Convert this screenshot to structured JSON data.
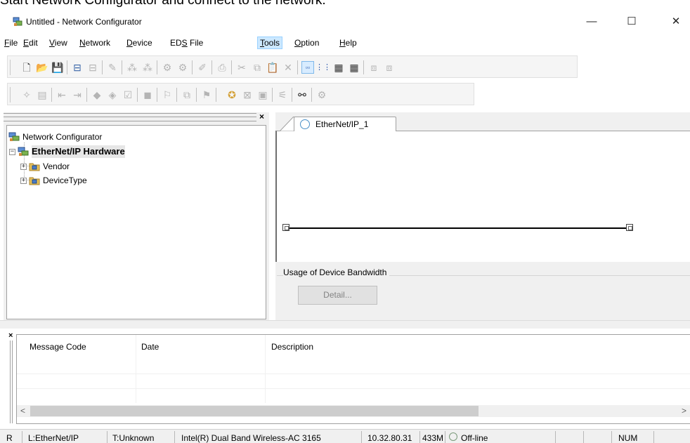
{
  "caption": "Start Network Configurator and connect to the network.",
  "window": {
    "title": "Untitled - Network Configurator",
    "controls": {
      "minimize": "—",
      "maximize": "☐",
      "close": "✕"
    }
  },
  "menubar": [
    {
      "label": "File",
      "accel": "F",
      "rest": "ile"
    },
    {
      "label": "Edit",
      "accel": "E",
      "rest": "dit"
    },
    {
      "label": "View",
      "accel": "V",
      "rest": "iew"
    },
    {
      "label": "Network",
      "accel": "N",
      "rest": "etwork"
    },
    {
      "label": "Device",
      "accel": "D",
      "rest": "evice"
    },
    {
      "label": "EDS File",
      "pre": "ED",
      "accel": "S",
      "rest": " File"
    },
    {
      "label": "Tools",
      "accel": "T",
      "rest": "ools",
      "highlighted": true
    },
    {
      "label": "Option",
      "accel": "O",
      "rest": "ption"
    },
    {
      "label": "Help",
      "accel": "H",
      "rest": "elp"
    }
  ],
  "tree": {
    "root": "Network Configurator",
    "hardware": "EtherNet/IP Hardware",
    "children": [
      "Vendor",
      "DeviceType"
    ]
  },
  "network_tab": {
    "label": "EtherNet/IP_1"
  },
  "bandwidth": {
    "label": "Usage of Device Bandwidth",
    "detail_button": "Detail..."
  },
  "messages": {
    "columns": [
      "Message Code",
      "Date",
      "Description"
    ],
    "scroll_left": "<",
    "scroll_right": ">"
  },
  "statusbar": {
    "ready": "R",
    "interface": "L:EtherNet/IP",
    "target": "T:Unknown",
    "adapter": "Intel(R) Dual Band Wireless-AC 3165",
    "ip": "10.32.80.31",
    "memory": "433M",
    "status": "Off-line",
    "numlock": "NUM"
  },
  "colors": {
    "menu_highlight": "#cce8ff",
    "panel_bg": "#f0f0f0",
    "tab_circle": "#4a8fc7"
  }
}
